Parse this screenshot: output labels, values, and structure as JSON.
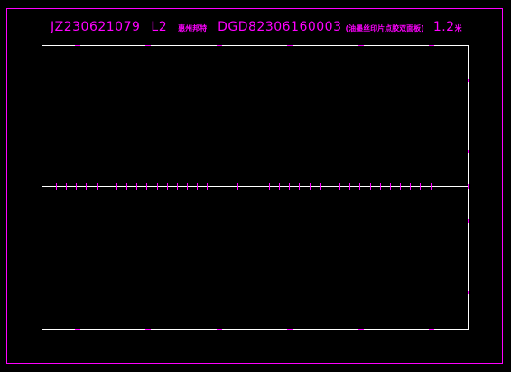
{
  "title": {
    "code": "JZ230621079",
    "layer": "L2",
    "customer": "惠州邦特",
    "order_no": "DGD82306160003",
    "material": "(油墨丝印片点胶双面板)",
    "thickness": "1.2",
    "thickness_unit": "米"
  },
  "colors": {
    "background": "#000000",
    "frame": "#ff00ff",
    "outline": "#ffffff",
    "marks": "#ff00ff",
    "text": "#ff00ff"
  }
}
